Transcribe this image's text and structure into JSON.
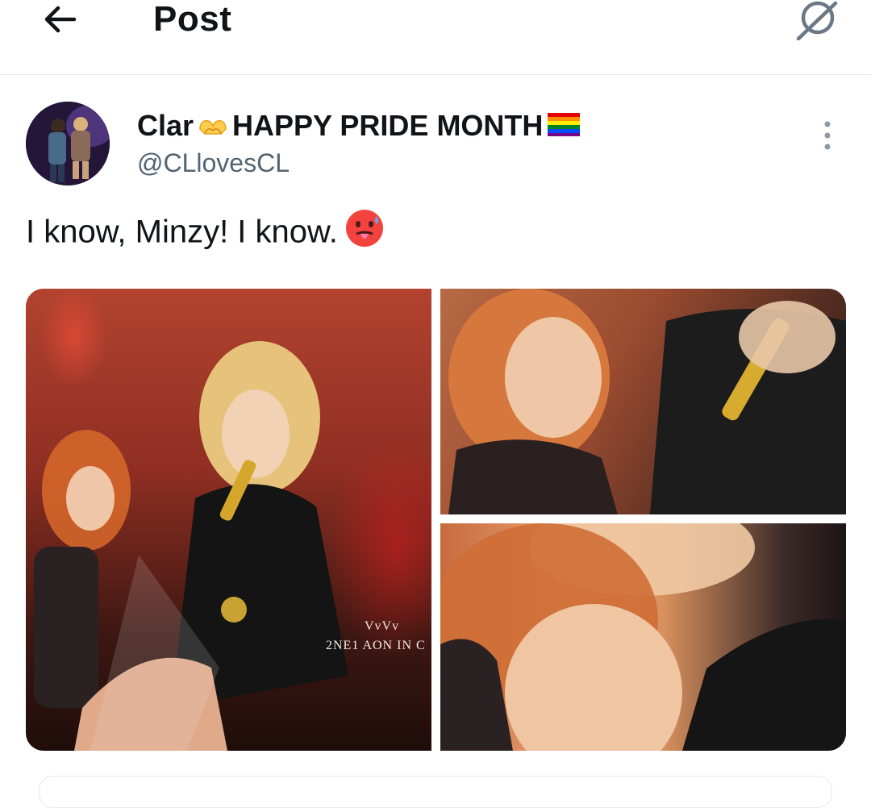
{
  "header": {
    "title": "Post",
    "back_icon": "back-arrow-icon",
    "grok_icon": "grok-icon"
  },
  "post": {
    "display_name": "Clar",
    "display_name_rest": "HAPPY PRIDE MONTH",
    "handle": "@CLlovesCL",
    "text": "I know, Minzy! I know.",
    "name_emojis": [
      "heart-hands-emoji",
      "rainbow-flag-emoji"
    ],
    "text_emoji": "hot-face-emoji",
    "more_icon": "more-vertical-icon"
  },
  "media": {
    "photos": [
      {
        "description_icon": "concert-photo",
        "watermark_line1": "VvVv",
        "watermark_line2": "2NE1 AON IN C"
      },
      {
        "description_icon": "concert-photo"
      },
      {
        "description_icon": "concert-photo"
      }
    ]
  },
  "colors": {
    "text_primary": "#0f1419",
    "text_secondary": "#536471",
    "divider": "#e6e8ea"
  }
}
